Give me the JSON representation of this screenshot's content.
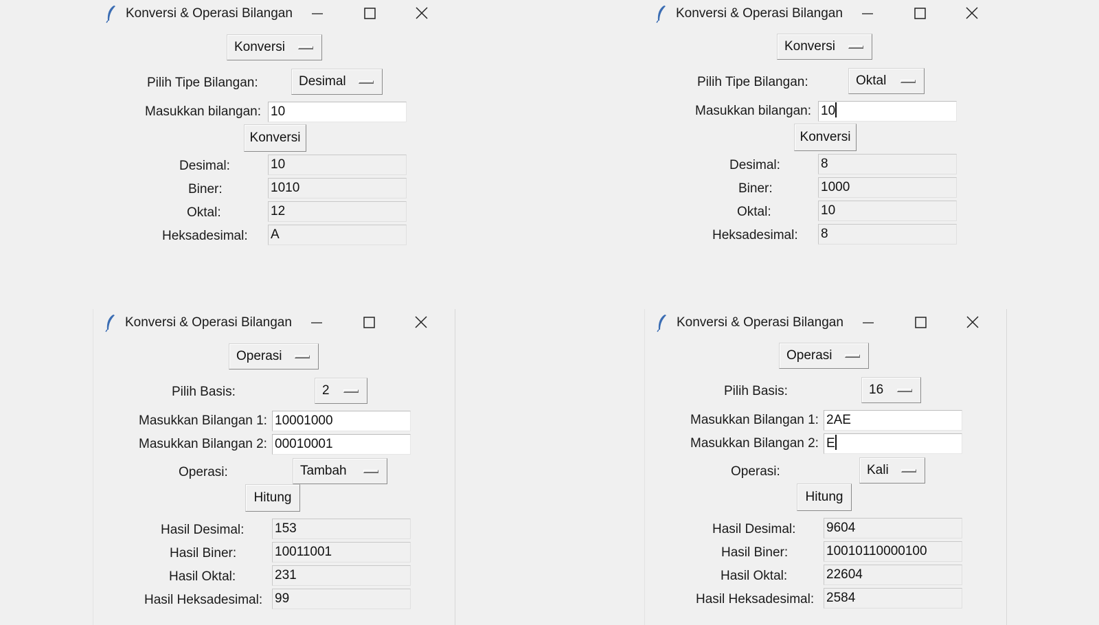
{
  "windows": [
    {
      "title": "Konversi & Operasi Bilangan",
      "mode": "Konversi",
      "type_label": "Pilih Tipe Bilangan:",
      "type_value": "Desimal",
      "input_label": "Masukkan bilangan:",
      "input_value": "10",
      "button": "Konversi",
      "results": [
        {
          "label": "Desimal:",
          "value": "10"
        },
        {
          "label": "Biner:",
          "value": "1010"
        },
        {
          "label": "Oktal:",
          "value": "12"
        },
        {
          "label": "Heksadesimal:",
          "value": "A"
        }
      ]
    },
    {
      "title": "Konversi & Operasi Bilangan",
      "mode": "Konversi",
      "type_label": "Pilih Tipe Bilangan:",
      "type_value": "Oktal",
      "input_label": "Masukkan bilangan:",
      "input_value": "10",
      "button": "Konversi",
      "results": [
        {
          "label": "Desimal:",
          "value": "8"
        },
        {
          "label": "Biner:",
          "value": "1000"
        },
        {
          "label": "Oktal:",
          "value": "10"
        },
        {
          "label": "Heksadesimal:",
          "value": "8"
        }
      ]
    },
    {
      "title": "Konversi & Operasi Bilangan",
      "mode": "Operasi",
      "basis_label": "Pilih Basis:",
      "basis_value": "2",
      "input1_label": "Masukkan Bilangan 1:",
      "input1_value": "10001000",
      "input2_label": "Masukkan Bilangan 2:",
      "input2_value": "00010001",
      "op_label": "Operasi:",
      "op_value": "Tambah",
      "button": "Hitung",
      "results": [
        {
          "label": "Hasil Desimal:",
          "value": "153"
        },
        {
          "label": "Hasil Biner:",
          "value": "10011001"
        },
        {
          "label": "Hasil Oktal:",
          "value": "231"
        },
        {
          "label": "Hasil Heksadesimal:",
          "value": "99"
        }
      ]
    },
    {
      "title": "Konversi & Operasi Bilangan",
      "mode": "Operasi",
      "basis_label": "Pilih Basis:",
      "basis_value": "16",
      "input1_label": "Masukkan Bilangan 1:",
      "input1_value": "2AE",
      "input2_label": "Masukkan Bilangan 2:",
      "input2_value": "E",
      "op_label": "Operasi:",
      "op_value": "Kali",
      "button": "Hitung",
      "results": [
        {
          "label": "Hasil Desimal:",
          "value": "9604"
        },
        {
          "label": "Hasil Biner:",
          "value": "10010110000100"
        },
        {
          "label": "Hasil Oktal:",
          "value": "22604"
        },
        {
          "label": "Hasil Heksadesimal:",
          "value": "2584"
        }
      ]
    }
  ]
}
